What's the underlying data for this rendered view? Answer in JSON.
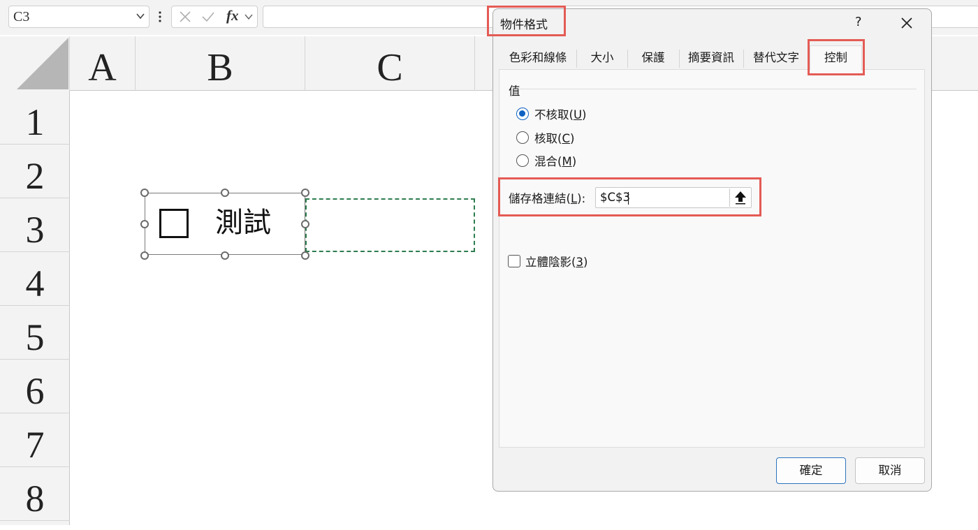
{
  "formula_bar": {
    "name_box": "C3",
    "fx_label": "fx",
    "formula": ""
  },
  "sheet": {
    "columns": [
      "A",
      "B",
      "C"
    ],
    "rows": [
      "1",
      "2",
      "3",
      "4",
      "5",
      "6",
      "7",
      "8"
    ],
    "checkbox_control": {
      "label": "測試",
      "checked": false
    }
  },
  "dialog": {
    "title": "物件格式",
    "help": "?",
    "tabs": [
      "色彩和線條",
      "大小",
      "保護",
      "摘要資訊",
      "替代文字",
      "控制"
    ],
    "active_tab": "控制",
    "value_group": {
      "label": "值",
      "options": [
        {
          "text": "不核取(",
          "key": "U",
          "tail": ")",
          "selected": true
        },
        {
          "text": "核取(",
          "key": "C",
          "tail": ")",
          "selected": false
        },
        {
          "text": "混合(",
          "key": "M",
          "tail": ")",
          "selected": false
        }
      ]
    },
    "cell_link": {
      "label_pre": "儲存格連結(",
      "label_key": "L",
      "label_post": "):",
      "value": "$C$3"
    },
    "shading": {
      "label_pre": "立體陰影(",
      "label_key": "3",
      "label_post": ")",
      "checked": false
    },
    "buttons": {
      "ok": "確定",
      "cancel": "取消"
    }
  },
  "colors": {
    "highlight": "#e45b55",
    "accent": "#0f62c2",
    "linked_cell_border": "#2e7d4f"
  }
}
